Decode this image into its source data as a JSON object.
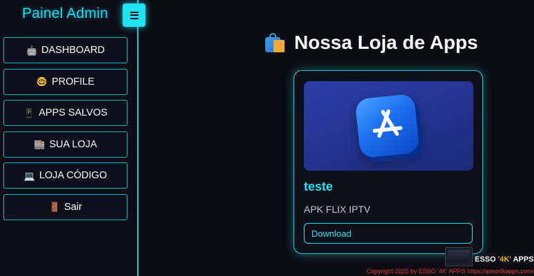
{
  "sidebar": {
    "brand": "Painel Admin",
    "items": [
      {
        "label": "DASHBOARD",
        "emoji": "🤖"
      },
      {
        "label": "PROFILE",
        "emoji": "🤓"
      },
      {
        "label": "APPS SALVOS",
        "emoji": "📱"
      },
      {
        "label": "SUA LOJA",
        "emoji": "🏬"
      },
      {
        "label": "LOJA CÓDIGO",
        "emoji": "💻"
      },
      {
        "label": "Sair",
        "emoji": "🚪"
      }
    ]
  },
  "main": {
    "title": "Nossa Loja de Apps",
    "card": {
      "title": "teste",
      "subtitle": "APK FLIX IPTV",
      "download_label": "Download"
    }
  },
  "watermark": {
    "brand_prefix": "ESSO ",
    "brand_accent": "'4K'",
    "brand_suffix": " APPS"
  },
  "footer": {
    "text": "Copyright 2025  by ESSO '4K' APPS https://esso4kapps.com/"
  },
  "colors": {
    "accent": "#1fe3f2",
    "background": "#0b0c14",
    "footer_text": "#e0342f"
  }
}
